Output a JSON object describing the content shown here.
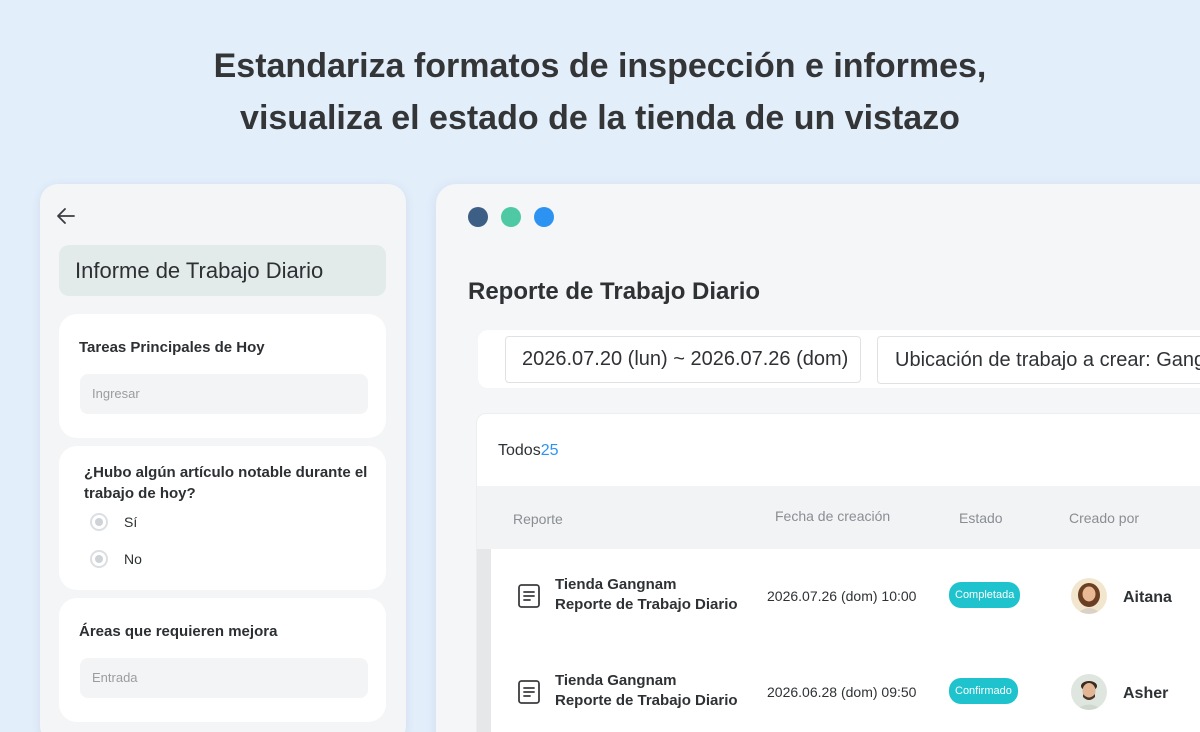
{
  "headline": {
    "line1": "Estandariza formatos de inspección e informes,",
    "line2": "visualiza el estado de la tienda de un vistazo"
  },
  "mobile": {
    "back_icon": "arrow-left-icon",
    "title": "Informe de Trabajo Diario",
    "cards": [
      {
        "label": "Tareas Principales de Hoy",
        "placeholder": "Ingresar"
      },
      {
        "label": "¿Hubo algún artículo notable durante el trabajo de hoy?",
        "options": [
          "Sí",
          "No"
        ]
      },
      {
        "label": "Áreas que requieren mejora",
        "placeholder": "Entrada"
      }
    ]
  },
  "desktop": {
    "window_dots": [
      "#3d5f86",
      "#4ec9a4",
      "#2d93f2"
    ],
    "title": "Reporte de Trabajo Diario",
    "date_range": "2026.07.20 (lun) ~ 2026.07.26 (dom)",
    "location": "Ubicación de trabajo a crear: Gangnam",
    "tab_all_label": "Todos",
    "tab_all_count": "25",
    "columns": [
      "Reporte",
      "Fecha de creación",
      "Estado",
      "Creado por"
    ],
    "rows": [
      {
        "name_line1": "Tienda Gangnam",
        "name_line2": "Reporte de Trabajo Diario",
        "date": "2026.07.26 (dom) 10:00",
        "status": "Completada",
        "author": "Aitana"
      },
      {
        "name_line1": "Tienda Gangnam",
        "name_line2": "Reporte de Trabajo Diario",
        "date": "2026.06.28 (dom) 09:50",
        "status": "Confirmado",
        "author": "Asher"
      }
    ],
    "status_color": "#1ec3cd",
    "accent": "#2d93f2"
  }
}
